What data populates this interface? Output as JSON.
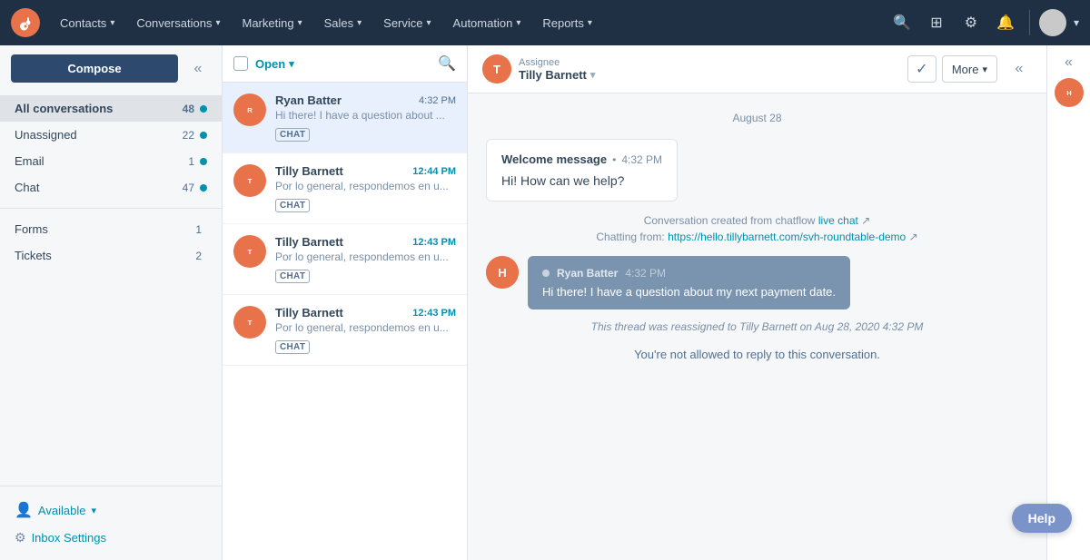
{
  "topnav": {
    "logo_label": "HubSpot",
    "nav_items": [
      {
        "label": "Contacts",
        "id": "contacts"
      },
      {
        "label": "Conversations",
        "id": "conversations"
      },
      {
        "label": "Marketing",
        "id": "marketing"
      },
      {
        "label": "Sales",
        "id": "sales"
      },
      {
        "label": "Service",
        "id": "service"
      },
      {
        "label": "Automation",
        "id": "automation"
      },
      {
        "label": "Reports",
        "id": "reports"
      }
    ],
    "icons": {
      "search": "🔍",
      "marketplace": "⊞",
      "settings": "⚙",
      "notifications": "🔔"
    }
  },
  "sidebar": {
    "compose_label": "Compose",
    "nav_items": [
      {
        "label": "All conversations",
        "count": 48,
        "dot": true,
        "active": true
      },
      {
        "label": "Unassigned",
        "count": 22,
        "dot": true,
        "active": false
      },
      {
        "label": "Email",
        "count": 1,
        "dot": true,
        "active": false
      },
      {
        "label": "Chat",
        "count": 47,
        "dot": true,
        "active": false
      },
      {
        "label": "Forms",
        "count": 1,
        "dot": false,
        "active": false
      },
      {
        "label": "Tickets",
        "count": 2,
        "dot": false,
        "active": false
      }
    ],
    "available_label": "Available",
    "inbox_settings_label": "Inbox Settings"
  },
  "conv_list": {
    "filter_label": "Open",
    "conversations": [
      {
        "name": "Ryan Batter",
        "time": "4:32 PM",
        "preview": "Hi there! I have a question about ...",
        "tag": "CHAT",
        "active": true,
        "unread": false,
        "avatar_initials": "R"
      },
      {
        "name": "Tilly Barnett",
        "time": "12:44 PM",
        "preview": "Por lo general, respondemos en u...",
        "tag": "CHAT",
        "active": false,
        "unread": true,
        "avatar_initials": "T"
      },
      {
        "name": "Tilly Barnett",
        "time": "12:43 PM",
        "preview": "Por lo general, respondemos en u...",
        "tag": "CHAT",
        "active": false,
        "unread": true,
        "avatar_initials": "T"
      },
      {
        "name": "Tilly Barnett",
        "time": "12:43 PM",
        "preview": "Por lo general, respondemos en u...",
        "tag": "CHAT",
        "active": false,
        "unread": true,
        "avatar_initials": "T"
      }
    ]
  },
  "chat": {
    "assignee_label": "Assignee",
    "assignee_name": "Tilly Barnett",
    "more_label": "More",
    "date_divider": "August 28",
    "welcome_message": {
      "title": "Welcome message",
      "time": "4:32 PM",
      "body": "Hi! How can we help?"
    },
    "system_info": {
      "line1_prefix": "Conversation created from chatflow",
      "line1_link": "live chat",
      "line2_prefix": "Chatting from:",
      "line2_link": "https://hello.tillybarnett.com/svh-roundtable-demo"
    },
    "user_message": {
      "sender": "Ryan Batter",
      "time": "4:32 PM",
      "body": "Hi there! I have a question about my next payment date."
    },
    "reassign_msg": "This thread was reassigned to Tilly Barnett on Aug 28, 2020 4:32 PM",
    "no_reply_msg": "You're not allowed to reply to this conversation."
  },
  "help_btn_label": "Help"
}
